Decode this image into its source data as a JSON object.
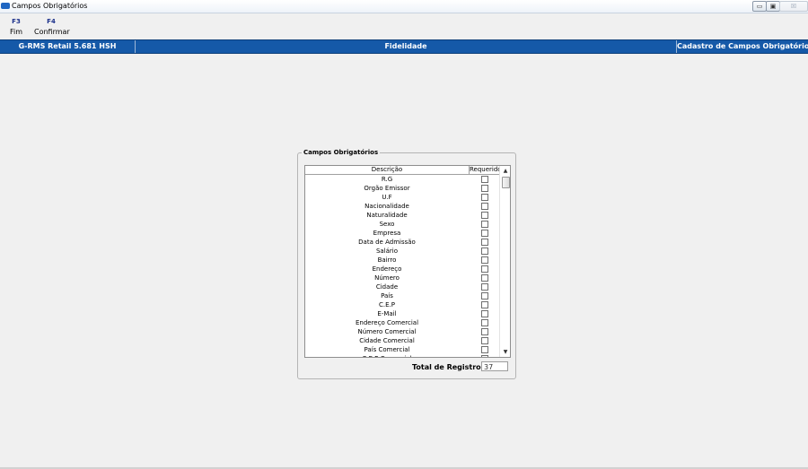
{
  "window": {
    "title": "Campos Obrigatórios",
    "min_label": "▭",
    "max_label": "▣",
    "close_label": "☒"
  },
  "toolbar": [
    {
      "key": "F3",
      "label": "Fim"
    },
    {
      "key": "F4",
      "label": "Confirmar"
    }
  ],
  "header": {
    "system": "G-RMS Retail 5.681 HSH",
    "module": "Fidelidade",
    "screen": "Cadastro de Campos Obrigatórios"
  },
  "group": {
    "title": "Campos Obrigatórios",
    "columns": {
      "descricao": "Descrição",
      "requerido": "Requerido"
    },
    "rows": [
      {
        "descricao": "R.G",
        "requerido": false
      },
      {
        "descricao": "Orgão Emissor",
        "requerido": false
      },
      {
        "descricao": "U.F",
        "requerido": false
      },
      {
        "descricao": "Nacionalidade",
        "requerido": false
      },
      {
        "descricao": "Naturalidade",
        "requerido": false
      },
      {
        "descricao": "Sexo",
        "requerido": false
      },
      {
        "descricao": "Empresa",
        "requerido": false
      },
      {
        "descricao": "Data de Admissão",
        "requerido": false
      },
      {
        "descricao": "Salário",
        "requerido": false
      },
      {
        "descricao": "Bairro",
        "requerido": false
      },
      {
        "descricao": "Endereço",
        "requerido": false
      },
      {
        "descricao": "Número",
        "requerido": false
      },
      {
        "descricao": "Cidade",
        "requerido": false
      },
      {
        "descricao": "País",
        "requerido": false
      },
      {
        "descricao": "C.E.P",
        "requerido": false
      },
      {
        "descricao": "E-Mail",
        "requerido": false
      },
      {
        "descricao": "Endereço Comercial",
        "requerido": false
      },
      {
        "descricao": "Número Comercial",
        "requerido": false
      },
      {
        "descricao": "Cidade Comercial",
        "requerido": false
      },
      {
        "descricao": "País Comercial",
        "requerido": false
      },
      {
        "descricao": "C.E.P Comercial",
        "requerido": false
      }
    ],
    "total_label": "Total de Registros :",
    "total_value": "37"
  },
  "icons": {
    "scroll_up": "▲",
    "scroll_down": "▼"
  }
}
